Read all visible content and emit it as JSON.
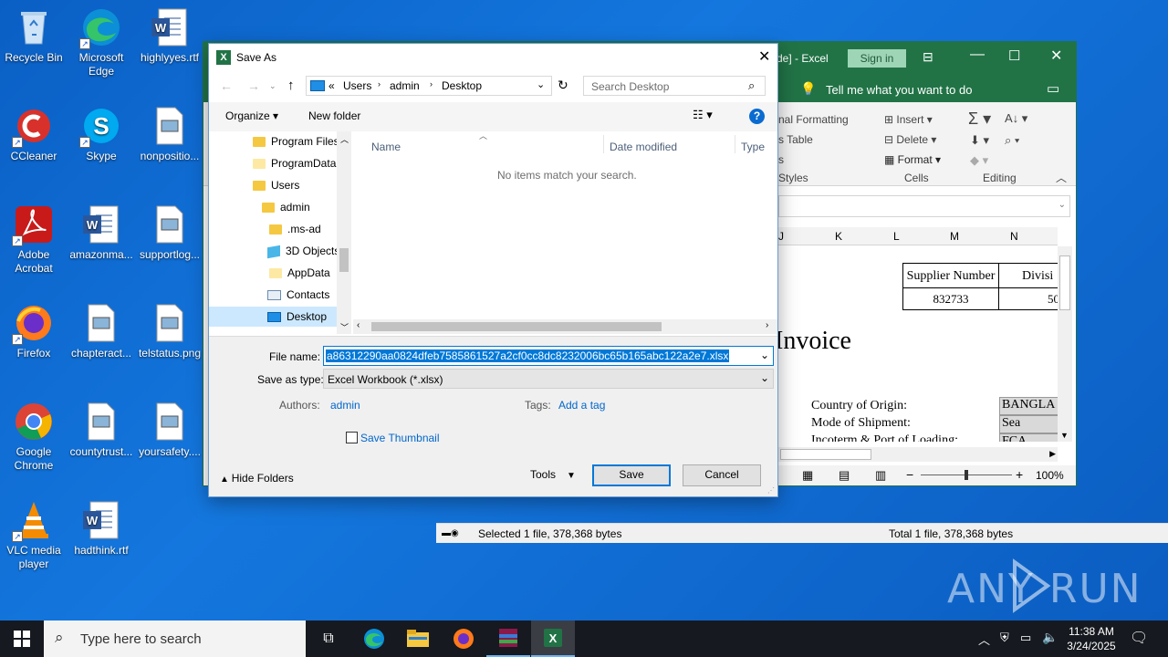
{
  "desktop": {
    "icons": [
      {
        "label": "Recycle Bin",
        "icon": "recycle-bin-icon"
      },
      {
        "label": "Microsoft Edge",
        "icon": "edge-icon"
      },
      {
        "label": "highlyyes.rtf",
        "icon": "word-doc-icon"
      },
      {
        "label": "CCleaner",
        "icon": "ccleaner-icon"
      },
      {
        "label": "Skype",
        "icon": "skype-icon"
      },
      {
        "label": "nonpositio...",
        "icon": "image-file-icon"
      },
      {
        "label": "Adobe Acrobat",
        "icon": "acrobat-icon"
      },
      {
        "label": "amazonma...",
        "icon": "word-doc-icon"
      },
      {
        "label": "supportlog...",
        "icon": "image-file-icon"
      },
      {
        "label": "Firefox",
        "icon": "firefox-icon"
      },
      {
        "label": "chapteract...",
        "icon": "image-file-icon"
      },
      {
        "label": "telstatus.png",
        "icon": "image-file-icon"
      },
      {
        "label": "Google Chrome",
        "icon": "chrome-icon"
      },
      {
        "label": "countytrust...",
        "icon": "image-file-icon"
      },
      {
        "label": "yoursafety....",
        "icon": "image-file-icon"
      },
      {
        "label": "VLC media player",
        "icon": "vlc-icon"
      },
      {
        "label": "hadthink.rtf",
        "icon": "word-doc-icon"
      }
    ]
  },
  "excel": {
    "title_fragment": "de] - Excel",
    "sign_in": "Sign in",
    "tell_me": "Tell me what you want to do",
    "ribbon": {
      "conditional_formatting": "nal Formatting",
      "format_table": "s Table",
      "styles_fragment": "s",
      "styles_label": "Styles",
      "insert": "Insert",
      "delete": "Delete",
      "format": "Format",
      "cells_label": "Cells",
      "editing_label": "Editing"
    },
    "columns": [
      "J",
      "K",
      "L",
      "M",
      "N"
    ],
    "sheet": {
      "supplier_number_label": "Supplier Number",
      "division_label": "Divisi",
      "supplier_number": "832733",
      "division": "50",
      "invoice_title": "Invoice",
      "country_label": "Country of Origin:",
      "country_value": "BANGLA",
      "shipment_label": "Mode of Shipment:",
      "shipment_value": "Sea",
      "incoterm_label": "Incoterm & Port of Loading:",
      "incoterm_value": "FCA"
    },
    "zoom": "100%"
  },
  "explorer_status": {
    "selected": "Selected 1 file, 378,368 bytes",
    "total": "Total 1 file, 378,368 bytes"
  },
  "dialog": {
    "title": "Save As",
    "breadcrumb": [
      "Users",
      "admin",
      "Desktop"
    ],
    "breadcrumb_prefix": "«",
    "search_placeholder": "Search Desktop",
    "organize": "Organize",
    "new_folder": "New folder",
    "tree": [
      {
        "label": "Program Files",
        "icon": "folder-icon"
      },
      {
        "label": "ProgramData",
        "icon": "folder-icon"
      },
      {
        "label": "Users",
        "icon": "folder-icon"
      },
      {
        "label": "admin",
        "icon": "folder-icon"
      },
      {
        "label": ".ms-ad",
        "icon": "folder-icon"
      },
      {
        "label": "3D Objects",
        "icon": "3d-objects-icon"
      },
      {
        "label": "AppData",
        "icon": "folder-icon"
      },
      {
        "label": "Contacts",
        "icon": "contacts-icon"
      },
      {
        "label": "Desktop",
        "icon": "desktop-folder-icon"
      }
    ],
    "columns": {
      "name": "Name",
      "date": "Date modified",
      "type": "Type"
    },
    "empty_message": "No items match your search.",
    "file_name_label": "File name:",
    "file_name_value": "a86312290aa0824dfeb7585861527a2cf0cc8dc8232006bc65b165abc122a2e7.xlsx",
    "save_type_label": "Save as type:",
    "save_type_value": "Excel Workbook (*.xlsx)",
    "authors_label": "Authors:",
    "authors_value": "admin",
    "tags_label": "Tags:",
    "tags_value": "Add a tag",
    "save_thumbnail": "Save Thumbnail",
    "hide_folders": "Hide Folders",
    "tools": "Tools",
    "save": "Save",
    "cancel": "Cancel"
  },
  "taskbar": {
    "search_placeholder": "Type here to search",
    "time": "11:38 AM",
    "date": "3/24/2025"
  },
  "watermark": "ANY RUN"
}
